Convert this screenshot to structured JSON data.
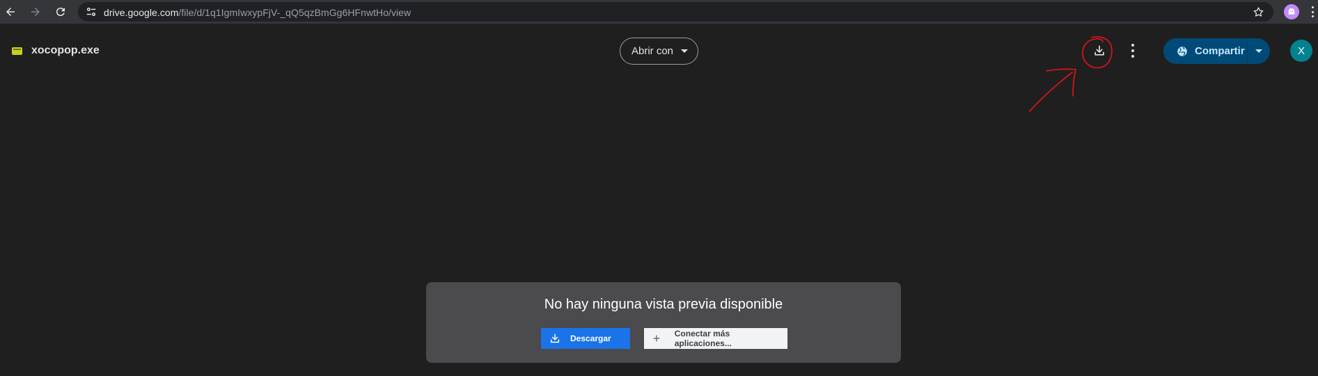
{
  "browser": {
    "url_host": "drive.google.com",
    "url_path": "/file/d/1q1IgmIwxypFjV-_qQ5qzBmGg6HFnwtHo/view",
    "icons": [
      "back-icon",
      "forward-icon",
      "reload-icon",
      "site-info-icon",
      "star-icon",
      "profile-icon",
      "menu-icon"
    ]
  },
  "toolbar": {
    "file_name": "xocopop.exe",
    "open_with_label": "Abrir con",
    "share_label": "Compartir",
    "avatar_letter": "X",
    "icons": [
      "file-type-icon",
      "download-icon",
      "more-icon",
      "globe-icon",
      "caret-icon"
    ]
  },
  "preview": {
    "message": "No hay ninguna vista previa disponible",
    "download_label": "Descargar",
    "connect_label": "Conectar más aplicaciones..."
  },
  "colors": {
    "background": "#1f1f20",
    "share_button": "#004a77",
    "download_button": "#1a73e8",
    "avatar": "#00838f",
    "annotation": "#d4141c"
  }
}
